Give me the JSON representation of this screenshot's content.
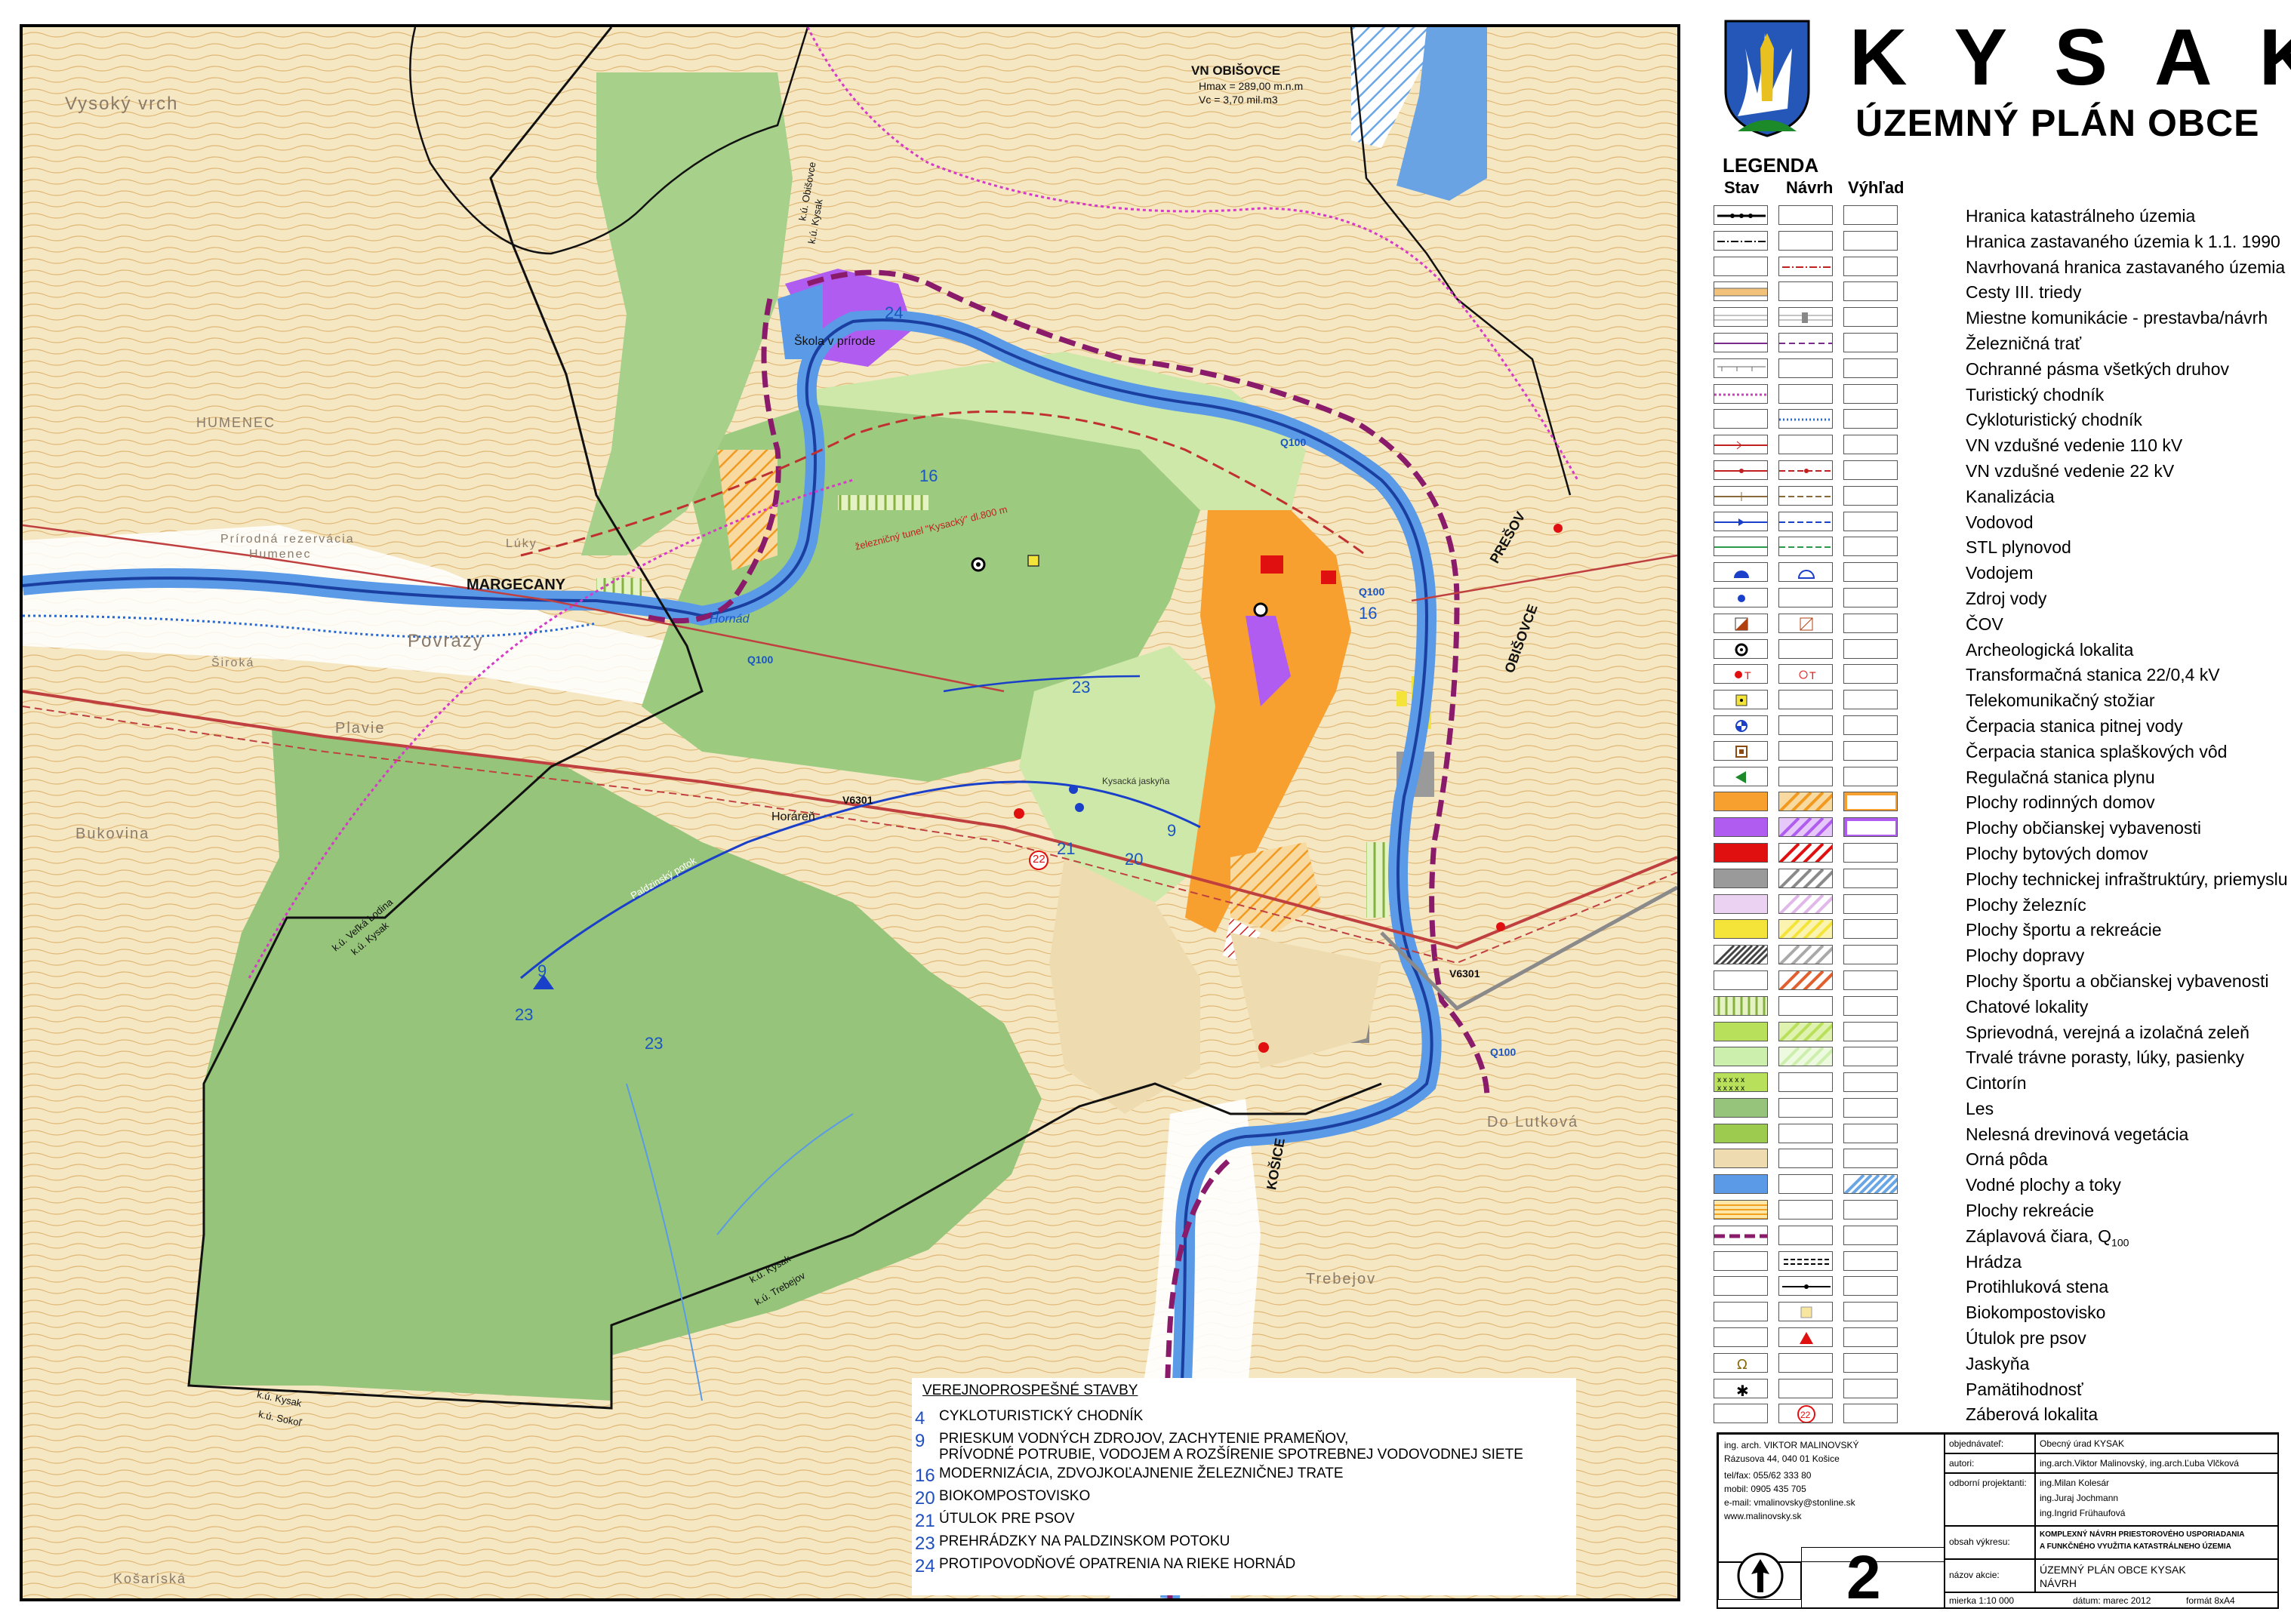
{
  "header": {
    "title": "KYSAK",
    "subtitle": "ÚZEMNÝ PLÁN OBCE"
  },
  "legend": {
    "title": "LEGENDA",
    "columns": [
      "Stav",
      "Návrh",
      "Výhľad"
    ],
    "items": [
      {
        "label": "Hranica katastrálneho územia",
        "symbol": "cadastral-boundary-icon"
      },
      {
        "label": "Hranica zastavaného územia k 1.1. 1990",
        "symbol": "built-up-boundary-icon"
      },
      {
        "label": "Navrhovaná hranica zastavaného územia",
        "symbol": "proposed-boundary-icon"
      },
      {
        "label": "Cesty III. triedy",
        "symbol": "road-class-3-icon"
      },
      {
        "label": "Miestne komunikácie - prestavba/návrh",
        "symbol": "local-road-icon"
      },
      {
        "label": "Železničná trať",
        "symbol": "railway-icon"
      },
      {
        "label": "Ochranné pásma všetkých druhov",
        "symbol": "protection-zone-icon"
      },
      {
        "label": "Turistický chodník",
        "symbol": "hiking-trail-icon"
      },
      {
        "label": "Cykloturistický chodník",
        "symbol": "cycle-trail-icon"
      },
      {
        "label": "VN vzdušné vedenie 110 kV",
        "symbol": "power-line-110-icon"
      },
      {
        "label": "VN vzdušné vedenie 22 kV",
        "symbol": "power-line-22-icon"
      },
      {
        "label": "Kanalizácia",
        "symbol": "sewer-icon"
      },
      {
        "label": "Vodovod",
        "symbol": "water-main-icon"
      },
      {
        "label": "STL plynovod",
        "symbol": "gas-pipeline-icon"
      },
      {
        "label": "Vodojem",
        "symbol": "water-reservoir-icon"
      },
      {
        "label": "Zdroj vody",
        "symbol": "water-source-icon"
      },
      {
        "label": "ČOV",
        "symbol": "wastewater-plant-icon"
      },
      {
        "label": "Archeologická lokalita",
        "symbol": "archaeological-site-icon"
      },
      {
        "label": "Transformačná stanica 22/0,4 kV",
        "symbol": "transformer-icon"
      },
      {
        "label": "Telekomunikačný stožiar",
        "symbol": "telecom-mast-icon"
      },
      {
        "label": "Čerpacia stanica pitnej vody",
        "symbol": "drinking-pump-icon"
      },
      {
        "label": "Čerpacia stanica splaškových vôd",
        "symbol": "sewage-pump-icon"
      },
      {
        "label": "Regulačná stanica plynu",
        "symbol": "gas-regulator-icon"
      },
      {
        "label": "Plochy rodinných domov",
        "symbol": "family-houses-area-icon"
      },
      {
        "label": "Plochy občianskej vybavenosti",
        "symbol": "civic-amenities-area-icon"
      },
      {
        "label": "Plochy bytových domov",
        "symbol": "apartment-area-icon"
      },
      {
        "label": "Plochy technickej infraštruktúry, priemyslu",
        "symbol": "technical-area-icon"
      },
      {
        "label": "Plochy železníc",
        "symbol": "railway-area-icon"
      },
      {
        "label": "Plochy športu a rekreácie",
        "symbol": "sport-area-icon"
      },
      {
        "label": "Plochy dopravy",
        "symbol": "transport-area-icon"
      },
      {
        "label": "Plochy športu a občianskej vybavenosti",
        "symbol": "sport-civic-area-icon"
      },
      {
        "label": "Chatové lokality",
        "symbol": "cottage-area-icon"
      },
      {
        "label": "Sprievodná, verejná a izolačná zeleň",
        "symbol": "public-greenery-icon"
      },
      {
        "label": "Trvalé trávne porasty, lúky, pasienky",
        "symbol": "grassland-icon"
      },
      {
        "label": "Cintorín",
        "symbol": "cemetery-icon"
      },
      {
        "label": "Les",
        "symbol": "forest-icon"
      },
      {
        "label": "Nelesná drevinová vegetácia",
        "symbol": "non-forest-vegetation-icon"
      },
      {
        "label": "Orná pôda",
        "symbol": "arable-land-icon"
      },
      {
        "label": "Vodné plochy a toky",
        "symbol": "water-bodies-icon"
      },
      {
        "label": "Plochy rekreácie",
        "symbol": "recreation-area-icon"
      },
      {
        "label": "Záplavová čiara, Q",
        "sub": "100",
        "symbol": "flood-line-icon"
      },
      {
        "label": "Hrádza",
        "symbol": "dike-icon"
      },
      {
        "label": "Protihluková stena",
        "symbol": "noise-barrier-icon"
      },
      {
        "label": "Biokompostovisko",
        "symbol": "compost-icon"
      },
      {
        "label": "Útulok pre psov",
        "symbol": "dog-shelter-icon"
      },
      {
        "label": "Jaskyňa",
        "symbol": "cave-icon"
      },
      {
        "label": "Pamätihodnosť",
        "symbol": "landmark-icon"
      },
      {
        "label": "Záberová lokalita",
        "symbol": "land-take-icon"
      }
    ]
  },
  "map": {
    "labels": {
      "obisovce_reservoir": "VN OBIŠOVCE",
      "obisovce_hmax": "Hmax = 289,00 m.n.m",
      "obisovce_vc": "Vc = 3,70 mil.m3",
      "vysoky_vrch": "Vysoký vrch",
      "humenec": "HUMENEC",
      "reservation_1": "Prírodná rezervácia",
      "reservation_2": "Humenec",
      "luky": "Lúky",
      "povrazy": "Povrazy",
      "siroka": "Široká",
      "plavie": "Plavie",
      "bukovina": "Bukovina",
      "horaren": "Horáreň",
      "margecany": "MARGECANY",
      "presov": "PREŠOV",
      "obisovce": "OBIŠOVCE",
      "kosice": "KOŠICE",
      "skola": "Škola v prírode",
      "tunnel": "železničný tunel \"Kysacký\" dl.800 m",
      "hornad": "Hornád",
      "kysacka_jaskyna": "Kysacká jaskyňa",
      "paldzinsky_potok": "Paldzinský potok",
      "dolutkova": "Do Lutková",
      "trebejov": "Trebejov",
      "kosariska": "Košariská",
      "q100_a": "Q100",
      "q100_b": "Q100",
      "q100_c": "Q100",
      "q100_d": "Q100",
      "v6301_a": "V6301",
      "v6301_b": "V6301",
      "ku_obisovce": "k.ú. Obišovce",
      "ku_kysak_top": "k.ú. Kysak",
      "ku_velka_lodina": "k.ú. Veľká Lodina",
      "ku_kysak_left": "k.ú. Kysak",
      "ku_kysak_bottom": "k.ú. Kysak",
      "ku_trebejov": "k.ú. Trebejov",
      "ku_kysak_sw": "k.ú. Kysak",
      "ku_sokol": "k.ú. Sokoľ",
      "n24": "24",
      "n16a": "16",
      "n16b": "16",
      "n23a": "23",
      "n23b": "23",
      "n23c": "23",
      "n9a": "9",
      "n9b": "9",
      "n20": "20",
      "n21": "21",
      "n22": "22"
    }
  },
  "public_works": {
    "title": "VEREJNOPROSPEŠNÉ STAVBY",
    "items": [
      {
        "num": "4",
        "text": "CYKLOTURISTICKÝ CHODNÍK"
      },
      {
        "num": "9",
        "text": "PRIESKUM VODNÝCH ZDROJOV, ZACHYTENIE PRAMEŇOV,",
        "text2": "PRÍVODNÉ POTRUBIE, VODOJEM A ROZŠÍRENIE SPOTREBNEJ VODOVODNEJ SIETE"
      },
      {
        "num": "16",
        "text": "MODERNIZÁCIA, ZDVOJKOĽAJNENIE ŽELEZNIČNEJ TRATE"
      },
      {
        "num": "20",
        "text": "BIOKOMPOSTOVISKO"
      },
      {
        "num": "21",
        "text": "ÚTULOK PRE PSOV"
      },
      {
        "num": "23",
        "text": "PREHRÁDZKY  NA PALDZINSKOM POTOKU"
      },
      {
        "num": "24",
        "text": "PROTIPOVODŇOVÉ OPATRENIA NA RIEKE HORNÁD"
      }
    ]
  },
  "title_block": {
    "author_name": "ing. arch. VIKTOR MALINOVSKÝ",
    "author_address": "Rázusova 44, 040 01 Košice",
    "author_tel": "tel/fax: 055/62 333 80",
    "author_mobil": "mobil: 0905 435 705",
    "author_email": "e-mail: vmalinovsky@stonline.sk",
    "author_web": "www.malinovsky.sk",
    "client_label": "objednávateľ:",
    "client_value": "Obecný úrad KYSAK",
    "authors_label": "autori:",
    "authors_value": "ing.arch.Viktor Malinovský, ing.arch.Ľuba Vlčková",
    "designers_label": "odborní projektanti:",
    "designer_1": "ing.Milan Kolesár",
    "designer_2": "ing.Juraj Jochmann",
    "designer_3": "ing.Ingrid Frühaufová",
    "content_label": "obsah výkresu:",
    "content_1": "KOMPLEXNÝ NÁVRH PRIESTOROVÉHO USPORIADANIA",
    "content_2": "A FUNKČNÉHO VYUŽITIA KATASTRÁLNEHO ÚZEMIA",
    "action_label": "názov akcie:",
    "action_1": "ÚZEMNÝ PLÁN OBCE KYSAK",
    "action_2": "NÁVRH",
    "scale": "mierka 1:10 000",
    "date": "dátum: marec 2012",
    "format": "formát 8xA4",
    "drawing_number": "2"
  },
  "colors": {
    "forest": "#96c47a",
    "meadow": "#cde8a8",
    "terrain": "#f6e7c3",
    "houses": "#f7a030",
    "civic": "#b05cf0",
    "water": "#5a9ae6",
    "flood": "#8a1a6a",
    "apartments": "#e11010"
  }
}
